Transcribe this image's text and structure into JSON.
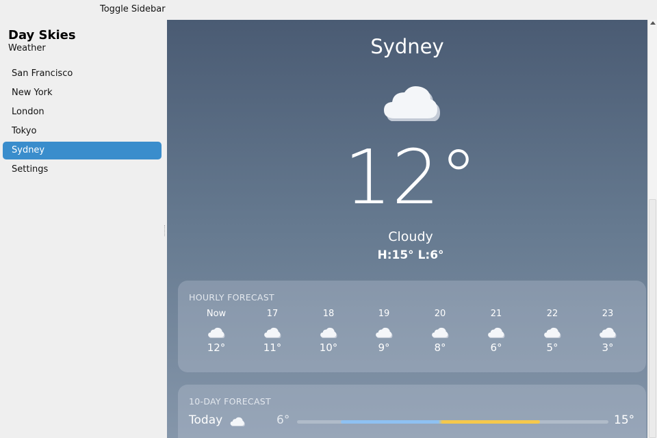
{
  "topbar": {
    "toggle_label": "Toggle Sidebar"
  },
  "sidebar": {
    "title": "Day Skies",
    "subtitle": "Weather",
    "items": [
      {
        "label": "San Francisco",
        "active": false
      },
      {
        "label": "New York",
        "active": false
      },
      {
        "label": "London",
        "active": false
      },
      {
        "label": "Tokyo",
        "active": false
      },
      {
        "label": "Sydney",
        "active": true
      },
      {
        "label": "Settings",
        "active": false
      }
    ]
  },
  "current": {
    "city": "Sydney",
    "icon": "cloud-icon",
    "temperature": "12°",
    "condition": "Cloudy",
    "hilo": "H:15° L:6°"
  },
  "hourly": {
    "title": "HOURLY FORECAST",
    "hours": [
      {
        "time": "Now",
        "icon": "cloud-icon",
        "temp": "12°"
      },
      {
        "time": "17",
        "icon": "cloud-icon",
        "temp": "11°"
      },
      {
        "time": "18",
        "icon": "cloud-icon",
        "temp": "10°"
      },
      {
        "time": "19",
        "icon": "cloud-icon",
        "temp": "9°"
      },
      {
        "time": "20",
        "icon": "cloud-icon",
        "temp": "8°"
      },
      {
        "time": "21",
        "icon": "cloud-icon",
        "temp": "6°"
      },
      {
        "time": "22",
        "icon": "cloud-icon",
        "temp": "5°"
      },
      {
        "time": "23",
        "icon": "cloud-icon",
        "temp": "3°"
      }
    ]
  },
  "daily": {
    "title": "10-DAY FORECAST",
    "days": [
      {
        "name": "Today",
        "icon": "cloud-icon",
        "low": "6°",
        "high": "15°",
        "range_start": 0.14,
        "range_end": 0.78
      }
    ]
  },
  "colors": {
    "accent": "#3a8dcc",
    "range_cool": "#8ec1f2",
    "range_warm": "#f5c84c"
  }
}
